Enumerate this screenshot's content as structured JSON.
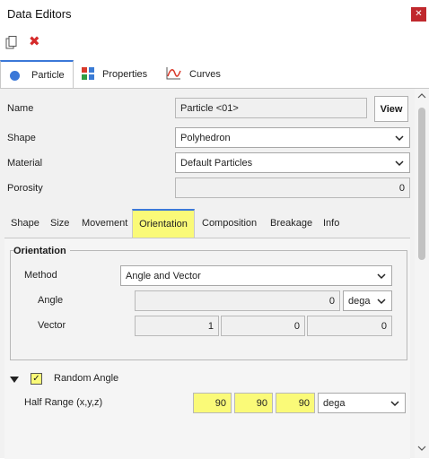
{
  "window": {
    "title": "Data Editors"
  },
  "main_tabs": [
    {
      "label": "Particle",
      "icon": "blue-circle-icon",
      "active": true
    },
    {
      "label": "Properties",
      "icon": "properties-grid-icon",
      "active": false
    },
    {
      "label": "Curves",
      "icon": "curve-chart-icon",
      "active": false
    }
  ],
  "form": {
    "name_label": "Name",
    "name_value": "Particle <01>",
    "view_button": "View",
    "shape_label": "Shape",
    "shape_value": "Polyhedron",
    "material_label": "Material",
    "material_value": "Default Particles",
    "porosity_label": "Porosity",
    "porosity_value": "0"
  },
  "sub_tabs": [
    "Shape",
    "Size",
    "Movement",
    "Orientation",
    "Composition",
    "Breakage",
    "Info"
  ],
  "active_sub_tab": "Orientation",
  "orientation": {
    "group_title": "Orientation",
    "method_label": "Method",
    "method_value": "Angle and Vector",
    "angle_label": "Angle",
    "angle_value": "0",
    "angle_unit": "dega",
    "vector_label": "Vector",
    "vector_values": [
      "1",
      "0",
      "0"
    ]
  },
  "random": {
    "label": "Random Angle",
    "checked": true,
    "half_range_label": "Half Range (x,y,z)",
    "half_range_values": [
      "90",
      "90",
      "90"
    ],
    "unit": "dega"
  },
  "colors": {
    "accent": "#3b78d8",
    "highlight": "#fafa78",
    "close": "#c0282d"
  }
}
